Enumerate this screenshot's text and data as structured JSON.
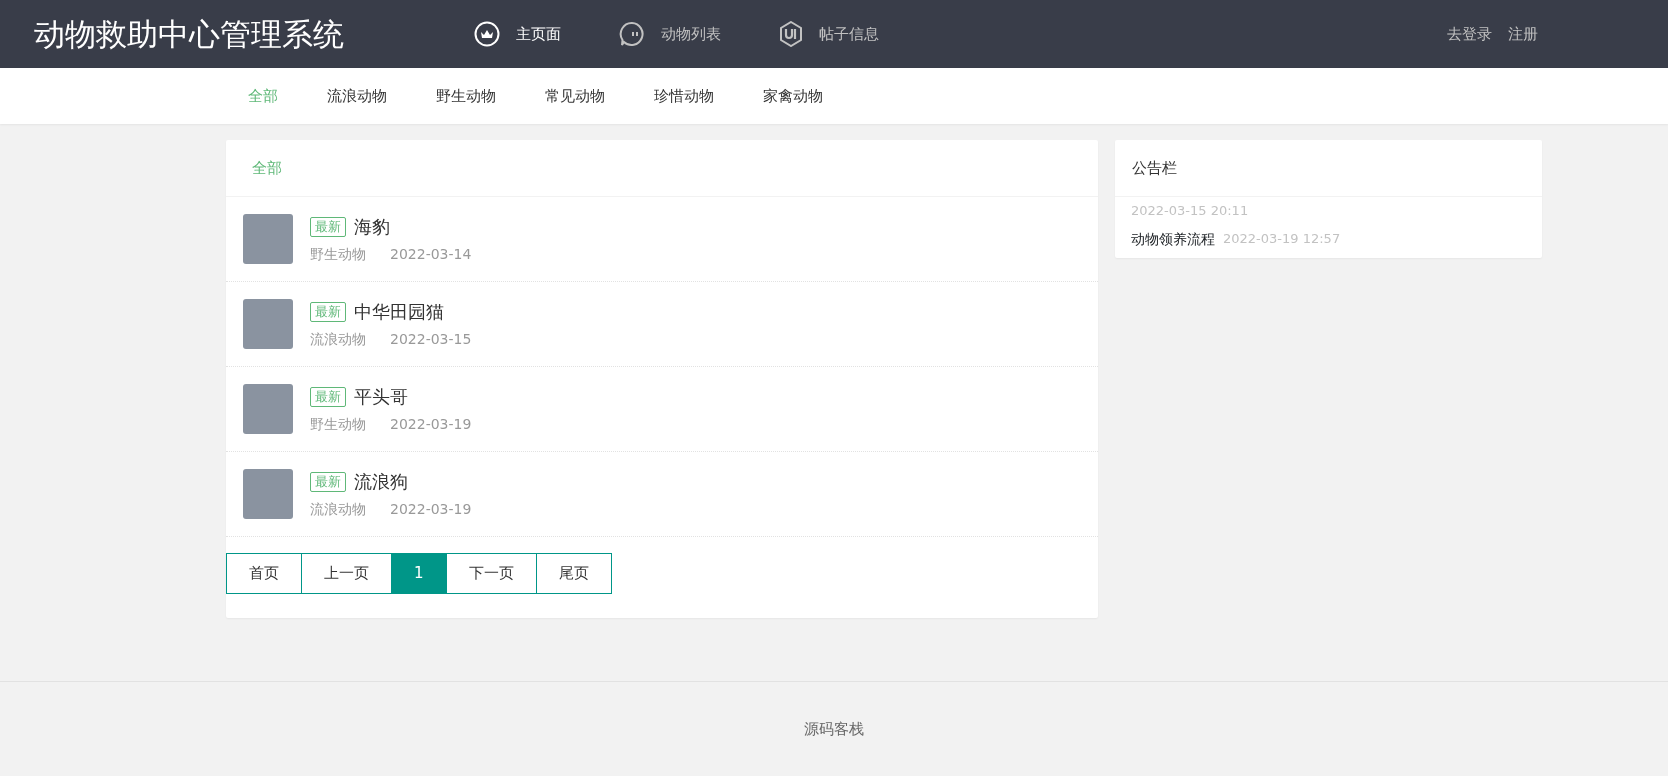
{
  "brand": "动物救助中心管理系统",
  "nav": [
    {
      "label": "主页面",
      "selected": true
    },
    {
      "label": "动物列表",
      "selected": false
    },
    {
      "label": "帖子信息",
      "selected": false
    }
  ],
  "auth_links": [
    "去登录",
    "注册"
  ],
  "categories": [
    {
      "label": "全部",
      "selected": true
    },
    {
      "label": "流浪动物",
      "selected": false
    },
    {
      "label": "野生动物",
      "selected": false
    },
    {
      "label": "常见动物",
      "selected": false
    },
    {
      "label": "珍惜动物",
      "selected": false
    },
    {
      "label": "家禽动物",
      "selected": false
    }
  ],
  "list": {
    "title": "全部",
    "items": [
      {
        "badge": "最新",
        "name": "海豹",
        "category": "野生动物",
        "date": "2022-03-14"
      },
      {
        "badge": "最新",
        "name": "中华田园猫",
        "category": "流浪动物",
        "date": "2022-03-15"
      },
      {
        "badge": "最新",
        "name": "平头哥",
        "category": "野生动物",
        "date": "2022-03-19"
      },
      {
        "badge": "最新",
        "name": "流浪狗",
        "category": "流浪动物",
        "date": "2022-03-19"
      }
    ]
  },
  "pagination": [
    {
      "label": "首页",
      "selected": false
    },
    {
      "label": "上一页",
      "selected": false
    },
    {
      "label": "1",
      "selected": true
    },
    {
      "label": "下一页",
      "selected": false
    },
    {
      "label": "尾页",
      "selected": false
    }
  ],
  "notice_board": {
    "title": "公告栏",
    "items": [
      {
        "date": "2022-03-15 20:11"
      },
      {
        "title": "动物领养流程",
        "date": "2022-03-19 12:57"
      }
    ]
  },
  "footer": "源码客栈"
}
